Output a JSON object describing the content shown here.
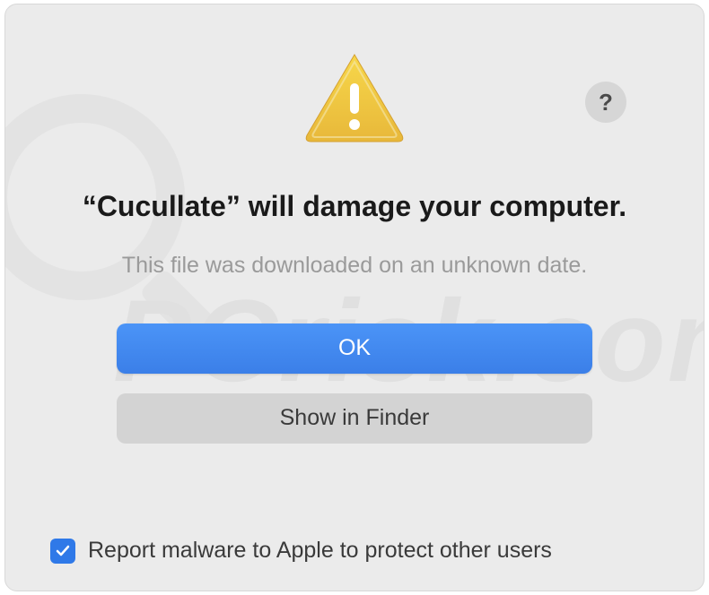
{
  "dialog": {
    "title": "“Cucullate” will damage your computer.",
    "subtitle": "This file was downloaded on an unknown date.",
    "help_symbol": "?",
    "buttons": {
      "ok": "OK",
      "show_in_finder": "Show in Finder"
    },
    "checkbox": {
      "checked": true,
      "label": "Report malware to Apple to protect other users"
    }
  },
  "watermark": {
    "text": "PCrisk.com"
  }
}
